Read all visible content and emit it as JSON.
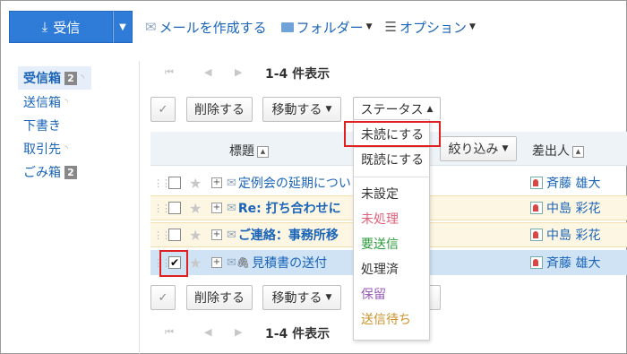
{
  "toolbar": {
    "receive_label": "受信",
    "compose_label": "メールを作成する",
    "folder_label": "フォルダー",
    "options_label": "オプション"
  },
  "sidebar": {
    "items": [
      {
        "label": "受信箱",
        "badge": "2",
        "active": true
      },
      {
        "label": "送信箱"
      },
      {
        "label": "下書き"
      },
      {
        "label": "取引先"
      },
      {
        "label": "ごみ箱",
        "badge": "2"
      }
    ]
  },
  "pager": {
    "top": "1-4 件表示",
    "bottom": "1-4 件表示"
  },
  "actions": {
    "delete_label": "削除する",
    "move_label": "移動する",
    "status_label": "ステータス",
    "filter_label": "絞り込み"
  },
  "table": {
    "col_subject": "標題",
    "col_sender": "差出人",
    "rows": [
      {
        "subject": "定例会の延期につい",
        "sender": "斉藤 雄大",
        "bold": false,
        "checked": false,
        "attach": false
      },
      {
        "subject": "Re: 打ち合わせに",
        "sender": "中島 彩花",
        "bold": true,
        "checked": false,
        "attach": false
      },
      {
        "subject": "ご連絡：事務所移",
        "sender": "中島 彩花",
        "bold": true,
        "checked": false,
        "attach": false
      },
      {
        "subject": "見積書の送付",
        "sender": "斉藤 雄大",
        "bold": false,
        "checked": true,
        "attach": true
      }
    ]
  },
  "status_menu": {
    "items": [
      {
        "label": "未読にする",
        "color": "#333333"
      },
      {
        "label": "既読にする",
        "color": "#333333"
      },
      {
        "label": "未設定",
        "color": "#333333"
      },
      {
        "label": "未処理",
        "color": "#e0607a"
      },
      {
        "label": "要送信",
        "color": "#2c9a3c"
      },
      {
        "label": "処理済",
        "color": "#333333"
      },
      {
        "label": "保留",
        "color": "#9a5ab8"
      },
      {
        "label": "送信待ち",
        "color": "#c9932c"
      }
    ]
  },
  "colors": {
    "accent": "#2e7bd8",
    "link": "#1a64b8",
    "highlight_box": "#e02020"
  }
}
